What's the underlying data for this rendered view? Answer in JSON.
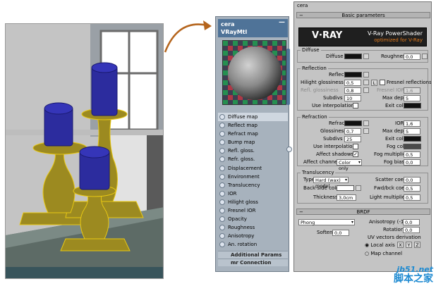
{
  "node": {
    "name": "cera",
    "type": "VRayMtl",
    "close": "—",
    "slots": [
      "Diffuse map",
      "Reflect map",
      "Refract map",
      "Bump map",
      "Refl. gloss.",
      "Refr. gloss.",
      "Displacement",
      "Environment",
      "Translucency",
      "IOR",
      "Hilight gloss",
      "Fresnel IOR",
      "Opacity",
      "Roughness",
      "Anisotropy",
      "An. rotation"
    ],
    "extra": [
      "Additional Params",
      "mr Connection"
    ]
  },
  "params": {
    "header_top": "cera",
    "basic_rollout": "Basic parameters",
    "banner_title": "V-Ray PowerShader",
    "banner_sub": "optimized for V-Ray",
    "diffuse": {
      "title": "Diffuse",
      "label": "Diffuse",
      "roughness_label": "Roughness",
      "roughness": "0,0"
    },
    "reflection": {
      "title": "Reflection",
      "reflect": "Reflect",
      "hilight_label": "Hilight glossiness",
      "hilight": "0,5",
      "l_btn": "L",
      "fresnel_label": "Fresnel reflections",
      "fresnel_ior_label": "Fresnel IOR",
      "fresnel_ior": "1,6",
      "refl_gloss_label": "Refl. glossiness",
      "refl_gloss": "0,8",
      "max_depth_label": "Max depth",
      "max_depth": "5",
      "subdivs_label": "Subdivs",
      "subdivs": "10",
      "exit_color_label": "Exit color",
      "use_interp_label": "Use interpolation"
    },
    "refraction": {
      "title": "Refraction",
      "refract": "Refract",
      "ior_label": "IOR",
      "ior": "1,6",
      "gloss_label": "Glossiness",
      "gloss": "0,7",
      "max_depth_label": "Max depth",
      "max_depth": "5",
      "subdivs_label": "Subdivs",
      "subdivs": "25",
      "exit_color_label": "Exit color",
      "use_interp_label": "Use interpolation",
      "fog_color_label": "Fog color",
      "affect_shadows_label": "Affect shadows",
      "fog_mult_label": "Fog multiplier",
      "fog_mult": "0,5",
      "affect_channels_label": "Affect channels",
      "affect_channels": "Color only",
      "fog_bias_label": "Fog bias",
      "fog_bias": "0,0"
    },
    "translucency": {
      "title": "Translucency",
      "type_label": "Type",
      "type": "Hard (wax) model",
      "scatter_label": "Scatter coeff",
      "scatter": "0,0",
      "back_color_label": "Back-side color",
      "fwd_bck_label": "Fwd/bck coeff",
      "fwd_bck": "0,5",
      "thickness_label": "Thickness",
      "thickness": "3,0cm",
      "light_mult_label": "Light multiplier",
      "light_mult": "0,5"
    },
    "brdf": {
      "rollout": "BRDF",
      "type": "Phong",
      "anisotropy_label": "Anisotropy (-1..1)",
      "anisotropy": "0,0",
      "rotation_label": "Rotation",
      "rotation": "0,0",
      "soften_label": "Soften",
      "soften": "0,0",
      "uv_label": "UV vectors derivation",
      "local_axis_label": "Local axis",
      "axes": [
        "X",
        "Y",
        "Z"
      ],
      "map_channel_label": "Map channel"
    }
  },
  "watermark": {
    "domain": "jb51.net",
    "brand": "脚本之家"
  },
  "colors": {
    "node_header": "#4f7398",
    "accent_orange": "#e07a1f",
    "wireframe": "#e8c814",
    "candle": "#2c2c9e"
  }
}
